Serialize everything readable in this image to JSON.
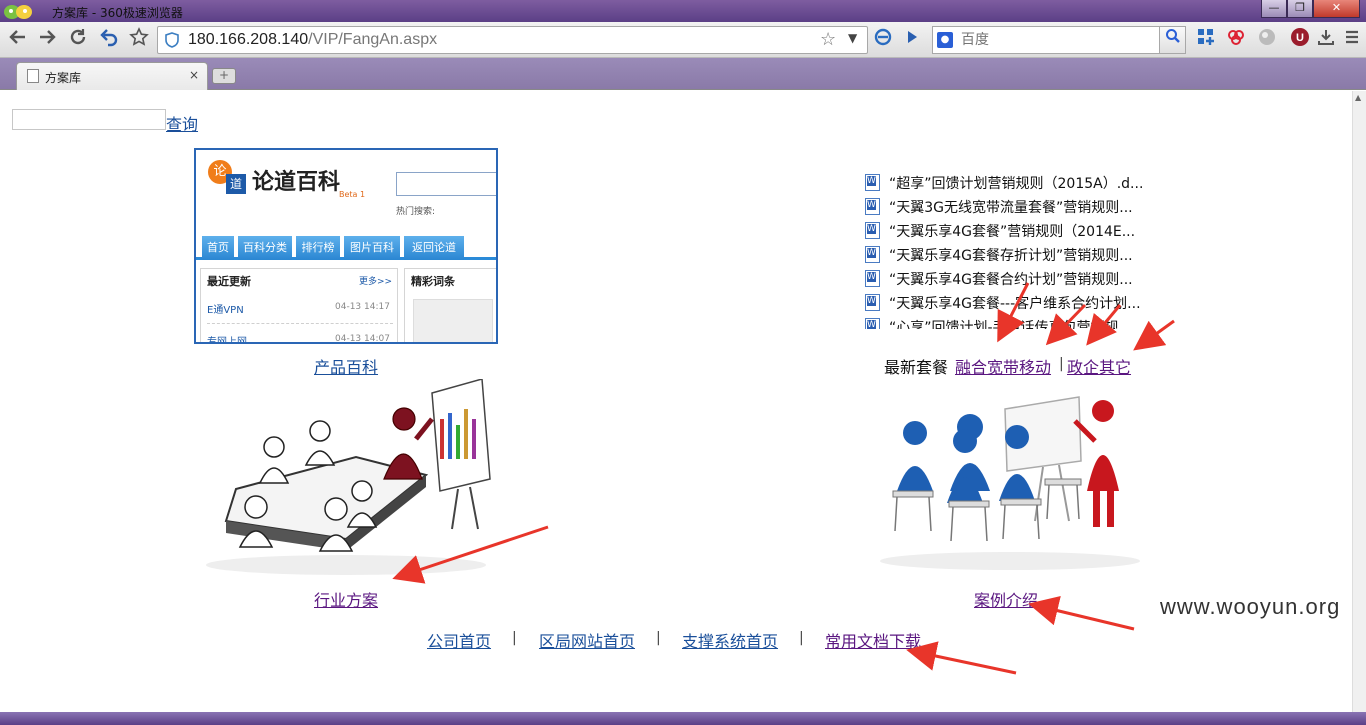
{
  "window": {
    "title": "方案库 - 360极速浏览器",
    "min_glyph": "—",
    "max_glyph": "❐",
    "close_glyph": "✕"
  },
  "toolbar": {
    "url_host": "180.166.208.140",
    "url_path": "/VIP/FangAn.aspx",
    "search_placeholder": "百度",
    "icons": [
      "back-icon",
      "forward-icon",
      "reload-icon",
      "undo-icon",
      "favorite-star-icon"
    ]
  },
  "tab": {
    "title": "方案库",
    "close_glyph": "×",
    "new_tab_glyph": "+"
  },
  "page": {
    "query_value": "",
    "query_link": "查询",
    "product_link": "产品百科",
    "latest_label": "最新套餐",
    "fusion_link": "融合宽带移动",
    "separator": "|",
    "gov_link": "政企其它",
    "industry_link": "行业方案",
    "case_link": "案例介绍",
    "footer_links": [
      "公司首页",
      "区局网站首页",
      "支撑系统首页",
      "常用文档下载"
    ],
    "watermark": "www.wooyun.org"
  },
  "baike_thumb": {
    "logo_char1": "论",
    "logo_char2": "道",
    "brand": "论道百科",
    "beta": "Beta 1",
    "hot": "热门搜索:",
    "tabs": [
      "首页",
      "百科分类",
      "排行榜",
      "图片百科",
      "返回论道"
    ],
    "left_title": "最近更新",
    "more": "更多>>",
    "rows": [
      {
        "name": "E通VPN",
        "time": "04-13 14:17"
      },
      {
        "name": "专网上网",
        "time": "04-13 14:07"
      }
    ],
    "right_title": "精彩词条"
  },
  "docs_thumb": {
    "items": [
      "“超享”回馈计划营销规则（2015A）.d...",
      "“天翼3G无线宽带流量套餐”营销规则...",
      "“天翼乐享4G套餐”营销规则（2014E...",
      "“天翼乐享4G套餐存折计划”营销规则...",
      "“天翼乐享4G套餐合约计划”营销规则...",
      "“天翼乐享4G套餐---客户维系合约计划...",
      "“心享”回馈计划-手电话传真包营销规..."
    ]
  },
  "colors": {
    "link": "#1a4f9a",
    "visited": "#5a1680",
    "arrow": "#e8352a",
    "titlebar": "#6a4c94"
  }
}
